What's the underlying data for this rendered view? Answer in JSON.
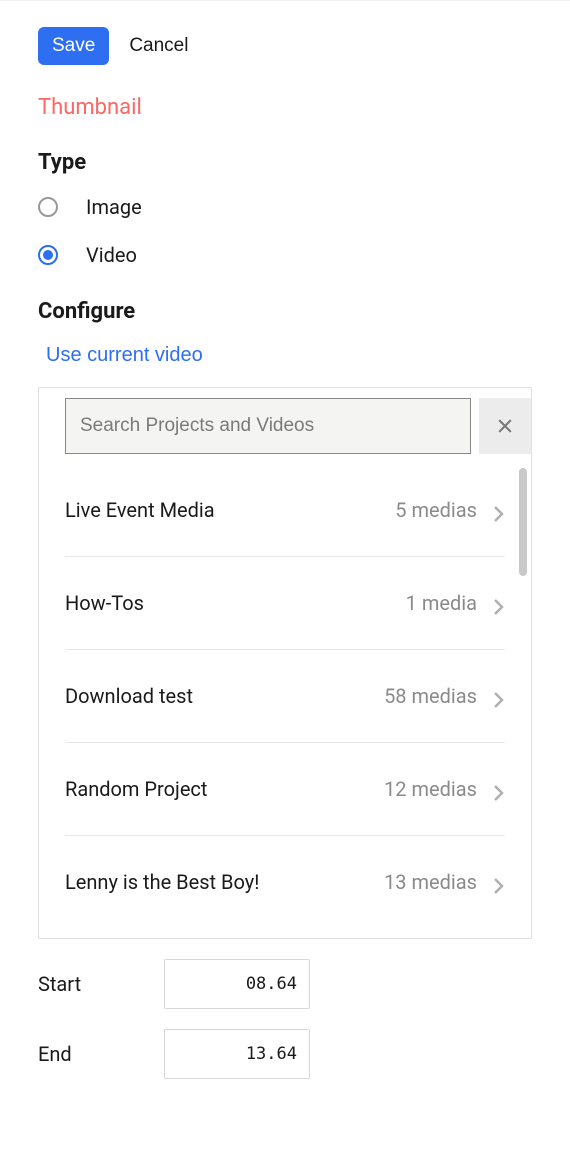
{
  "actions": {
    "save_label": "Save",
    "cancel_label": "Cancel"
  },
  "thumbnail_heading": "Thumbnail",
  "type_section": {
    "heading": "Type",
    "options": {
      "image": "Image",
      "video": "Video"
    },
    "selected": "video"
  },
  "configure_section": {
    "heading": "Configure",
    "use_current_label": "Use current video",
    "search_placeholder": "Search Projects and Videos",
    "projects": [
      {
        "name": "Live Event Media",
        "count_label": "5 medias"
      },
      {
        "name": "How-Tos",
        "count_label": "1 media"
      },
      {
        "name": "Download test",
        "count_label": "58 medias"
      },
      {
        "name": "Random Project",
        "count_label": "12 medias"
      },
      {
        "name": "Lenny is the Best Boy!",
        "count_label": "13 medias"
      }
    ]
  },
  "time": {
    "start_label": "Start",
    "start_value": "08.64",
    "end_label": "End",
    "end_value": "13.64"
  }
}
